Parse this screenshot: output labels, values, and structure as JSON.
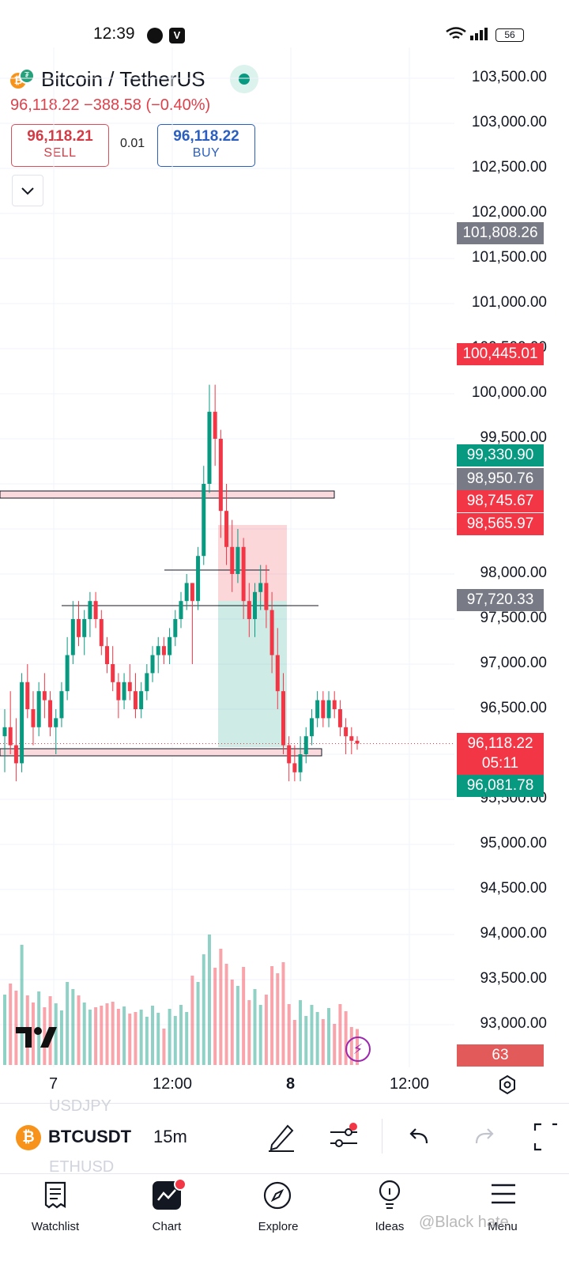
{
  "status_bar": {
    "time": "12:39",
    "battery": "56"
  },
  "header": {
    "symbol": "Bitcoin / TetherUS",
    "price_change": "96,118.22  −388.58 (−0.40%)",
    "sell": {
      "price": "96,118.21",
      "label": "SELL"
    },
    "buy": {
      "price": "96,118.22",
      "label": "BUY"
    },
    "spread": "0.01"
  },
  "price_axis": {
    "labels": [
      "103,500.00",
      "103,000.00",
      "102,500.00",
      "102,000.00",
      "101,500.00",
      "101,000.00",
      "100,500.00",
      "100,000.00",
      "99,500.00",
      "98,000.00",
      "97,500.00",
      "97,000.00",
      "96,500.00",
      "95,500.00",
      "95,000.00",
      "94,500.00",
      "94,000.00",
      "93,500.00",
      "93,000.00"
    ],
    "tags": [
      {
        "text": "101,808.26",
        "color": "#787b86"
      },
      {
        "text": "100,445.01",
        "color": "#f23645"
      },
      {
        "text": "99,330.90",
        "color": "#089981"
      },
      {
        "text": "98,950.76",
        "color": "#787b86"
      },
      {
        "text": "98,745.67",
        "color": "#f23645"
      },
      {
        "text": "98,565.97",
        "color": "#f23645"
      },
      {
        "text": "97,720.33",
        "color": "#787b86"
      },
      {
        "text": "96,118.22",
        "color": "#f23645"
      },
      {
        "text": "05:11",
        "color": "#f23645"
      },
      {
        "text": "96,081.78",
        "color": "#089981"
      },
      {
        "text": "63",
        "color": "#e25a5a"
      }
    ]
  },
  "time_axis": [
    "7",
    "12:00",
    "8",
    "12:00"
  ],
  "toolbar": {
    "symbol": "BTCUSDT",
    "interval": "15m",
    "ghost_above": "USDJPY",
    "ghost_below": "ETHUSD"
  },
  "bottom_nav": [
    "Watchlist",
    "Chart",
    "Explore",
    "Ideas",
    "Menu"
  ],
  "watermark": "@Black hate",
  "chart_data": {
    "type": "candlestick",
    "symbol": "BTCUSDT",
    "interval": "15m",
    "ylim": [
      92800,
      103700
    ],
    "last_price": 96118.22,
    "candles": [
      [
        96200,
        96500,
        95800,
        96300
      ],
      [
        96300,
        96700,
        96000,
        96100
      ],
      [
        96100,
        96400,
        95700,
        95900
      ],
      [
        95900,
        96900,
        95800,
        96800
      ],
      [
        96800,
        97000,
        96400,
        96500
      ],
      [
        96500,
        96700,
        96100,
        96300
      ],
      [
        96300,
        96800,
        96200,
        96700
      ],
      [
        96700,
        96900,
        96400,
        96600
      ],
      [
        96600,
        96700,
        96200,
        96300
      ],
      [
        96300,
        96500,
        96000,
        96400
      ],
      [
        96400,
        96800,
        96300,
        96700
      ],
      [
        96700,
        97300,
        96600,
        97100
      ],
      [
        97100,
        97700,
        97000,
        97500
      ],
      [
        97500,
        97700,
        97200,
        97300
      ],
      [
        97300,
        97600,
        97100,
        97500
      ],
      [
        97500,
        97800,
        97300,
        97700
      ],
      [
        97700,
        97800,
        97400,
        97500
      ],
      [
        97500,
        97600,
        97100,
        97200
      ],
      [
        97200,
        97300,
        96900,
        97000
      ],
      [
        97000,
        97200,
        96700,
        96800
      ],
      [
        96800,
        96900,
        96400,
        96600
      ],
      [
        96600,
        96900,
        96500,
        96800
      ],
      [
        96800,
        97000,
        96600,
        96700
      ],
      [
        96700,
        96900,
        96400,
        96500
      ],
      [
        96500,
        96800,
        96400,
        96700
      ],
      [
        96700,
        97000,
        96600,
        96900
      ],
      [
        96900,
        97200,
        96800,
        97100
      ],
      [
        97100,
        97300,
        96900,
        97200
      ],
      [
        97200,
        97300,
        97000,
        97100
      ],
      [
        97100,
        97400,
        97000,
        97300
      ],
      [
        97300,
        97600,
        97200,
        97500
      ],
      [
        97500,
        97800,
        97400,
        97700
      ],
      [
        97700,
        98000,
        97600,
        97900
      ],
      [
        97900,
        97900,
        97000,
        97700
      ],
      [
        97700,
        98300,
        97600,
        98200
      ],
      [
        98200,
        99200,
        98100,
        99000
      ],
      [
        99000,
        100100,
        98900,
        99800
      ],
      [
        99800,
        100100,
        99200,
        99500
      ],
      [
        99500,
        99600,
        98400,
        98700
      ],
      [
        98700,
        99000,
        98100,
        98300
      ],
      [
        98300,
        98600,
        97800,
        98000
      ],
      [
        98000,
        98500,
        97900,
        98300
      ],
      [
        98300,
        98400,
        97500,
        97700
      ],
      [
        97700,
        97900,
        97300,
        97500
      ],
      [
        97500,
        97900,
        97300,
        97800
      ],
      [
        97800,
        98100,
        97600,
        97900
      ],
      [
        97900,
        98100,
        97400,
        97600
      ],
      [
        97600,
        97800,
        96900,
        97100
      ],
      [
        97100,
        97400,
        96500,
        96700
      ],
      [
        96700,
        96900,
        96000,
        96100
      ],
      [
        96100,
        96200,
        95700,
        95900
      ],
      [
        95900,
        96100,
        95700,
        95800
      ],
      [
        95800,
        96200,
        95700,
        96000
      ],
      [
        96000,
        96300,
        95900,
        96200
      ],
      [
        96200,
        96500,
        96100,
        96400
      ],
      [
        96400,
        96700,
        96300,
        96600
      ],
      [
        96600,
        96700,
        96300,
        96400
      ],
      [
        96400,
        96700,
        96300,
        96600
      ],
      [
        96600,
        96700,
        96400,
        96500
      ],
      [
        96500,
        96600,
        96200,
        96300
      ],
      [
        96300,
        96400,
        96000,
        96200
      ],
      [
        96200,
        96300,
        96000,
        96150
      ],
      [
        96150,
        96200,
        96050,
        96118
      ]
    ],
    "levels": [
      98950.76,
      97720.33,
      96081.78
    ],
    "volume_last": 63
  }
}
